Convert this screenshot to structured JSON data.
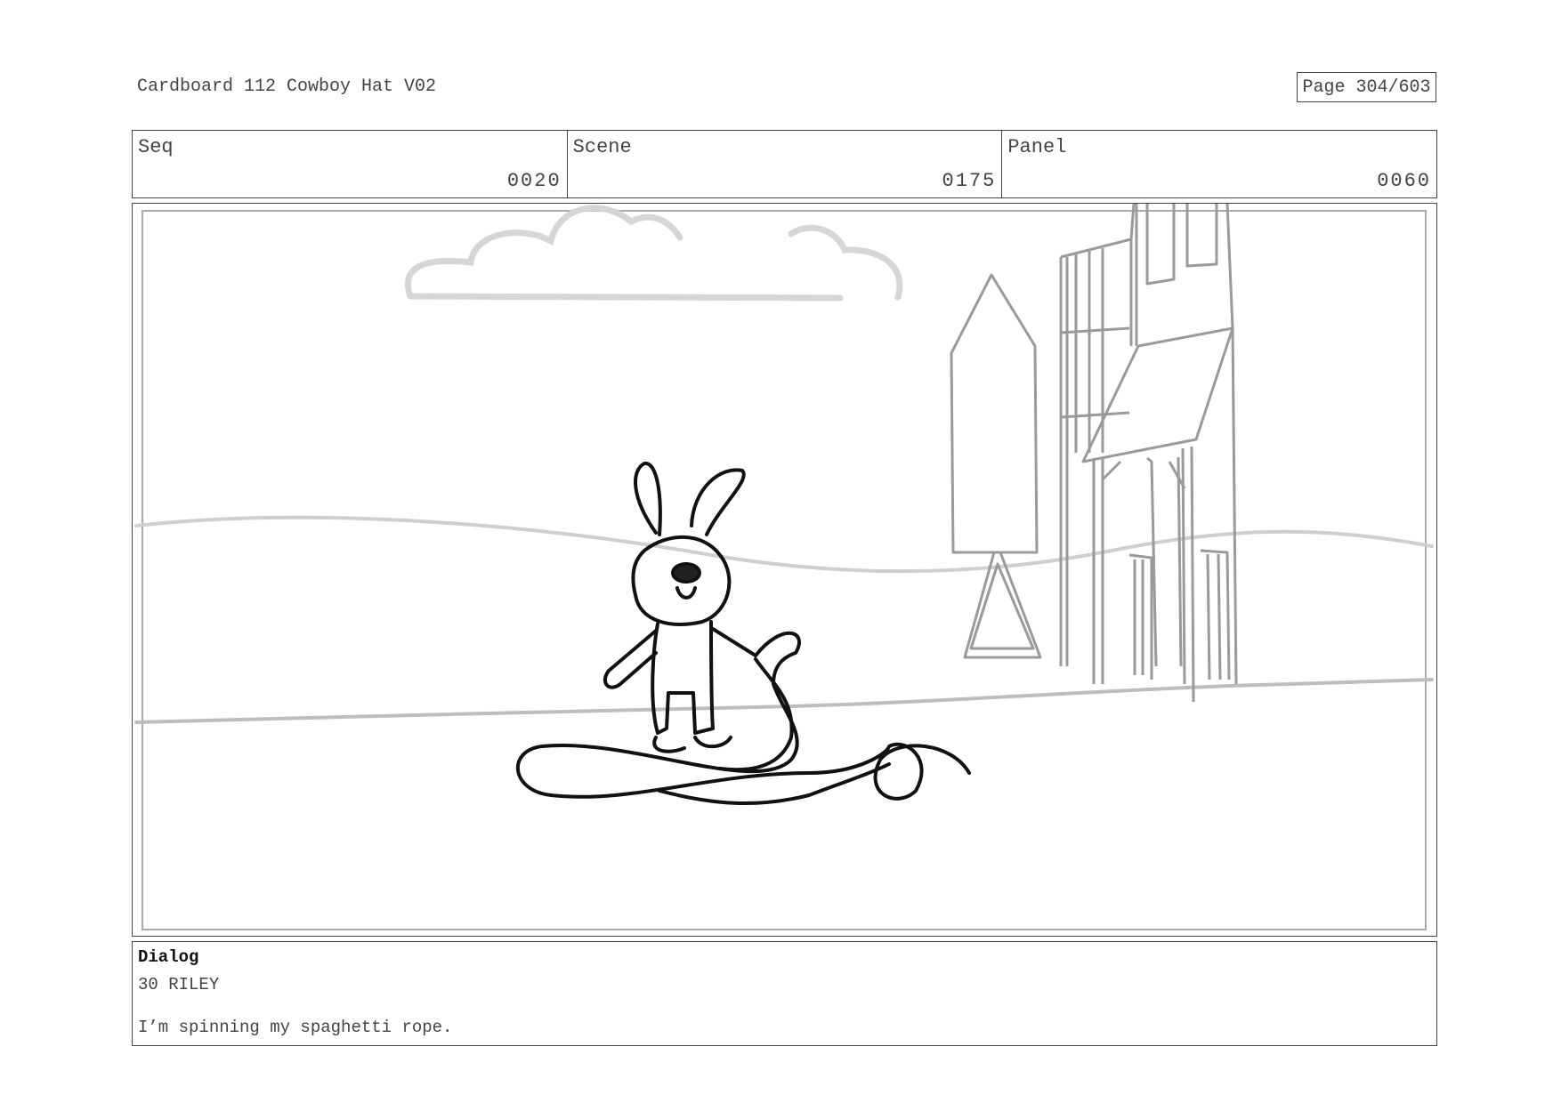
{
  "document": {
    "title": "Cardboard 112 Cowboy Hat V02",
    "page_label": "Page 304/603"
  },
  "info": {
    "seq_label": "Seq",
    "seq_value": "0020",
    "scene_label": "Scene",
    "scene_value": "0175",
    "panel_label": "Panel",
    "panel_value": "0060"
  },
  "dialog": {
    "heading": "Dialog",
    "speaker": "30 RILEY",
    "line": "I’m spinning my spaghetti rope."
  }
}
